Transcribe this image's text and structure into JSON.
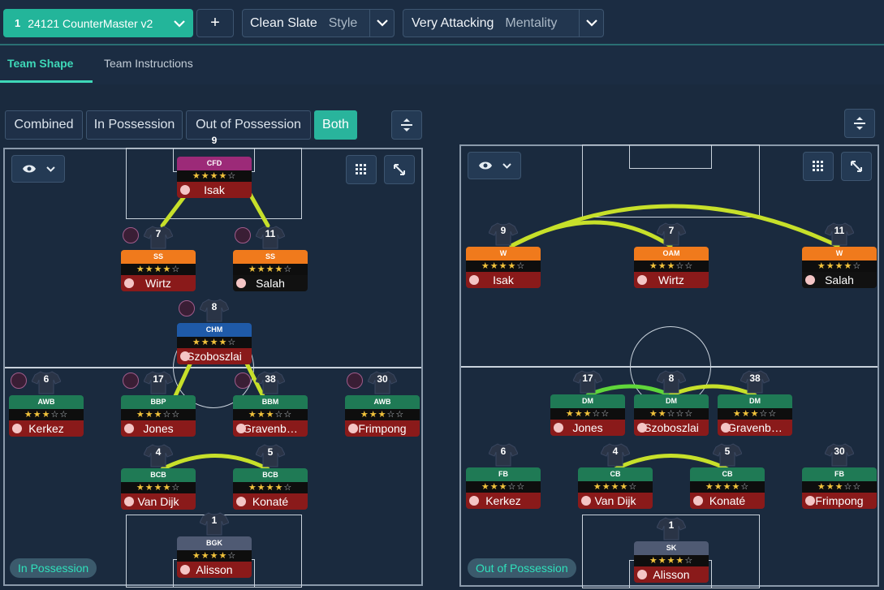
{
  "top_bar": {
    "tactic_number": "1",
    "tactic_name": "24121 CounterMaster v2",
    "add_label": "+",
    "style_value": "Clean Slate",
    "style_label": "Style",
    "mentality_value": "Very Attacking",
    "mentality_label": "Mentality"
  },
  "tabs": [
    {
      "label": "Team Shape",
      "active": true
    },
    {
      "label": "Team Instructions",
      "active": false
    }
  ],
  "view_toggle": [
    "Combined",
    "In Possession",
    "Out of Possession",
    "Both"
  ],
  "view_toggle_active": "Both",
  "pitch_left": {
    "label": "In Possession",
    "players": [
      {
        "number": "9",
        "role": "CFD",
        "role_color": "#9c2a78",
        "stars": 4,
        "half_star": false,
        "name": "Isak",
        "name_color": "#8a1a1a",
        "badge": false,
        "shirt": false
      },
      {
        "number": "7",
        "role": "SS",
        "role_color": "#f07a1c",
        "stars": 3,
        "half_star": true,
        "name": "Wirtz",
        "name_color": "#8a1a1a",
        "badge": true,
        "shirt": true
      },
      {
        "number": "11",
        "role": "SS",
        "role_color": "#f07a1c",
        "stars": 4,
        "half_star": false,
        "name": "Salah",
        "name_color": "#111111",
        "badge": true,
        "shirt": true
      },
      {
        "number": "8",
        "role": "CHM",
        "role_color": "#1f5aa8",
        "stars": 3,
        "half_star": true,
        "name": "Szoboszlai",
        "name_color": "#8a1a1a",
        "badge": true,
        "shirt": true
      },
      {
        "number": "6",
        "role": "AWB",
        "role_color": "#1f7a55",
        "stars": 3,
        "half_star": false,
        "name": "Kerkez",
        "name_color": "#8a1a1a",
        "badge": true,
        "shirt": true
      },
      {
        "number": "17",
        "role": "BBP",
        "role_color": "#1f7a55",
        "stars": 3,
        "half_star": false,
        "name": "Jones",
        "name_color": "#8a1a1a",
        "badge": true,
        "shirt": true
      },
      {
        "number": "38",
        "role": "BBM",
        "role_color": "#1f7a55",
        "stars": 3,
        "half_star": false,
        "name": "Gravenb…",
        "name_color": "#8a1a1a",
        "badge": true,
        "shirt": true
      },
      {
        "number": "30",
        "role": "AWB",
        "role_color": "#1f7a55",
        "stars": 3,
        "half_star": false,
        "name": "Frimpong",
        "name_color": "#8a1a1a",
        "badge": true,
        "shirt": true
      },
      {
        "number": "4",
        "role": "BCB",
        "role_color": "#1f7a55",
        "stars": 4,
        "half_star": false,
        "name": "Van Dijk",
        "name_color": "#8a1a1a",
        "badge": false,
        "shirt": true
      },
      {
        "number": "5",
        "role": "BCB",
        "role_color": "#1f7a55",
        "stars": 4,
        "half_star": false,
        "name": "Konaté",
        "name_color": "#8a1a1a",
        "badge": false,
        "shirt": true
      },
      {
        "number": "1",
        "role": "BGK",
        "role_color": "#4f5a73",
        "stars": 4,
        "half_star": false,
        "name": "Alisson",
        "name_color": "#8a1a1a",
        "badge": false,
        "shirt": true
      }
    ]
  },
  "pitch_right": {
    "label": "Out of Possession",
    "players": [
      {
        "number": "9",
        "role": "W",
        "role_color": "#f07a1c",
        "stars": 4,
        "half_star": false,
        "name": "Isak",
        "name_color": "#8a1a1a",
        "badge": false,
        "shirt": true
      },
      {
        "number": "7",
        "role": "OAM",
        "role_color": "#f07a1c",
        "stars": 3,
        "half_star": false,
        "name": "Wirtz",
        "name_color": "#8a1a1a",
        "badge": false,
        "shirt": true
      },
      {
        "number": "11",
        "role": "W",
        "role_color": "#f07a1c",
        "stars": 4,
        "half_star": false,
        "name": "Salah",
        "name_color": "#111111",
        "badge": false,
        "shirt": true
      },
      {
        "number": "17",
        "role": "DM",
        "role_color": "#1f7a55",
        "stars": 2,
        "half_star": true,
        "name": "Jones",
        "name_color": "#8a1a1a",
        "badge": false,
        "shirt": true
      },
      {
        "number": "8",
        "role": "DM",
        "role_color": "#1f7a55",
        "stars": 2,
        "half_star": false,
        "name": "Szoboszlai",
        "name_color": "#8a1a1a",
        "badge": false,
        "shirt": true
      },
      {
        "number": "38",
        "role": "DM",
        "role_color": "#1f7a55",
        "stars": 3,
        "half_star": false,
        "name": "Gravenb…",
        "name_color": "#8a1a1a",
        "badge": false,
        "shirt": true
      },
      {
        "number": "6",
        "role": "FB",
        "role_color": "#1f7a55",
        "stars": 3,
        "half_star": false,
        "name": "Kerkez",
        "name_color": "#8a1a1a",
        "badge": false,
        "shirt": true
      },
      {
        "number": "4",
        "role": "CB",
        "role_color": "#1f7a55",
        "stars": 4,
        "half_star": false,
        "name": "Van Dijk",
        "name_color": "#8a1a1a",
        "badge": false,
        "shirt": true
      },
      {
        "number": "5",
        "role": "CB",
        "role_color": "#1f7a55",
        "stars": 4,
        "half_star": false,
        "name": "Konaté",
        "name_color": "#8a1a1a",
        "badge": false,
        "shirt": true
      },
      {
        "number": "30",
        "role": "FB",
        "role_color": "#1f7a55",
        "stars": 2,
        "half_star": true,
        "name": "Frimpong",
        "name_color": "#8a1a1a",
        "badge": false,
        "shirt": true
      },
      {
        "number": "1",
        "role": "SK",
        "role_color": "#4f5a73",
        "stars": 4,
        "half_star": false,
        "name": "Alisson",
        "name_color": "#8a1a1a",
        "badge": false,
        "shirt": true
      }
    ]
  },
  "colors": {
    "accent": "#29b49c",
    "link_yellow": "#c7e02a",
    "link_green": "#5fd63a"
  }
}
